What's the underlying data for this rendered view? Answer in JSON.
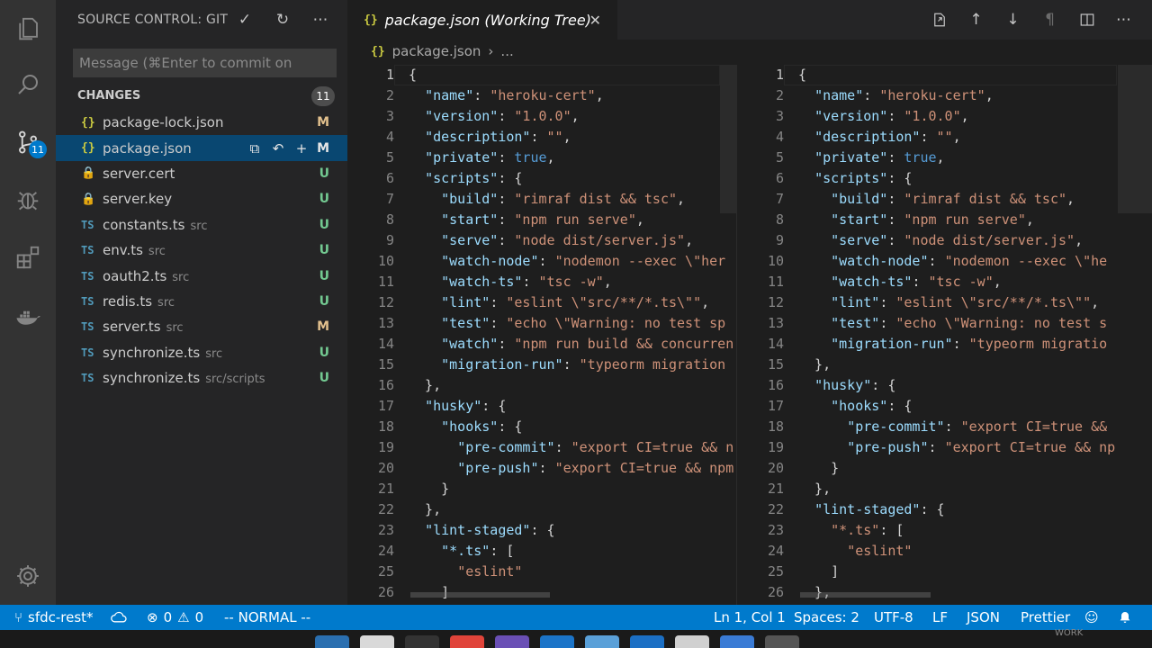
{
  "activity_bar": {
    "items": [
      {
        "name": "explorer-icon"
      },
      {
        "name": "search-icon"
      },
      {
        "name": "source-control-icon",
        "badge": "11"
      },
      {
        "name": "debug-icon"
      },
      {
        "name": "extensions-icon"
      },
      {
        "name": "docker-icon"
      },
      {
        "name": "settings-gear-icon"
      }
    ]
  },
  "sidebar": {
    "title": "SOURCE CONTROL: GIT",
    "actions": [
      "commit-check-icon",
      "refresh-icon",
      "more-actions-icon"
    ],
    "commit_placeholder": "Message (⌘Enter to commit on",
    "changes_label": "CHANGES",
    "changes_count": "11",
    "files": [
      {
        "icon": "{}",
        "type": "json",
        "name": "package-lock.json",
        "dir": "",
        "status": "M"
      },
      {
        "icon": "{}",
        "type": "json",
        "name": "package.json",
        "dir": "",
        "status": "M",
        "selected": true
      },
      {
        "icon": "🔒",
        "type": "lock",
        "name": "server.cert",
        "dir": "",
        "status": "U"
      },
      {
        "icon": "🔒",
        "type": "lock",
        "name": "server.key",
        "dir": "",
        "status": "U"
      },
      {
        "icon": "TS",
        "type": "ts",
        "name": "constants.ts",
        "dir": "src",
        "status": "U"
      },
      {
        "icon": "TS",
        "type": "ts",
        "name": "env.ts",
        "dir": "src",
        "status": "U"
      },
      {
        "icon": "TS",
        "type": "ts",
        "name": "oauth2.ts",
        "dir": "src",
        "status": "U"
      },
      {
        "icon": "TS",
        "type": "ts",
        "name": "redis.ts",
        "dir": "src",
        "status": "U"
      },
      {
        "icon": "TS",
        "type": "ts",
        "name": "server.ts",
        "dir": "src",
        "status": "M"
      },
      {
        "icon": "TS",
        "type": "ts",
        "name": "synchronize.ts",
        "dir": "src",
        "status": "U"
      },
      {
        "icon": "TS",
        "type": "ts",
        "name": "synchronize.ts",
        "dir": "src/scripts",
        "status": "U"
      }
    ]
  },
  "editor": {
    "tab_icon": "{}",
    "tab_title": "package.json (Working Tree)",
    "tab_close": "✕",
    "actions": [
      "open-file-icon",
      "arrow-up-icon",
      "arrow-down-icon",
      "pilcrow-icon",
      "split-editor-icon",
      "more-icon"
    ],
    "breadcrumb_icon": "{}",
    "breadcrumb_file": "package.json",
    "breadcrumb_sep": "›",
    "breadcrumb_more": "...",
    "left_lines": [
      [
        [
          "p",
          "{"
        ]
      ],
      [
        [
          "p",
          "  "
        ],
        [
          "k",
          "\"name\""
        ],
        [
          "p",
          ": "
        ],
        [
          "s",
          "\"heroku-cert\""
        ],
        [
          "p",
          ","
        ]
      ],
      [
        [
          "p",
          "  "
        ],
        [
          "k",
          "\"version\""
        ],
        [
          "p",
          ": "
        ],
        [
          "s",
          "\"1.0.0\""
        ],
        [
          "p",
          ","
        ]
      ],
      [
        [
          "p",
          "  "
        ],
        [
          "k",
          "\"description\""
        ],
        [
          "p",
          ": "
        ],
        [
          "s",
          "\"\""
        ],
        [
          "p",
          ","
        ]
      ],
      [
        [
          "p",
          "  "
        ],
        [
          "k",
          "\"private\""
        ],
        [
          "p",
          ": "
        ],
        [
          "b",
          "true"
        ],
        [
          "p",
          ","
        ]
      ],
      [
        [
          "p",
          "  "
        ],
        [
          "k",
          "\"scripts\""
        ],
        [
          "p",
          ": {"
        ]
      ],
      [
        [
          "p",
          "    "
        ],
        [
          "k",
          "\"build\""
        ],
        [
          "p",
          ": "
        ],
        [
          "s",
          "\"rimraf dist && tsc\""
        ],
        [
          "p",
          ","
        ]
      ],
      [
        [
          "p",
          "    "
        ],
        [
          "k",
          "\"start\""
        ],
        [
          "p",
          ": "
        ],
        [
          "s",
          "\"npm run serve\""
        ],
        [
          "p",
          ","
        ]
      ],
      [
        [
          "p",
          "    "
        ],
        [
          "k",
          "\"serve\""
        ],
        [
          "p",
          ": "
        ],
        [
          "s",
          "\"node dist/server.js\""
        ],
        [
          "p",
          ","
        ]
      ],
      [
        [
          "p",
          "    "
        ],
        [
          "k",
          "\"watch-node\""
        ],
        [
          "p",
          ": "
        ],
        [
          "s",
          "\"nodemon --exec \\\"her"
        ]
      ],
      [
        [
          "p",
          "    "
        ],
        [
          "k",
          "\"watch-ts\""
        ],
        [
          "p",
          ": "
        ],
        [
          "s",
          "\"tsc -w\""
        ],
        [
          "p",
          ","
        ]
      ],
      [
        [
          "p",
          "    "
        ],
        [
          "k",
          "\"lint\""
        ],
        [
          "p",
          ": "
        ],
        [
          "s",
          "\"eslint \\\"src/**/*.ts\\\"\""
        ],
        [
          "p",
          ","
        ]
      ],
      [
        [
          "p",
          "    "
        ],
        [
          "k",
          "\"test\""
        ],
        [
          "p",
          ": "
        ],
        [
          "s",
          "\"echo \\\"Warning: no test sp"
        ]
      ],
      [
        [
          "p",
          "    "
        ],
        [
          "k",
          "\"watch\""
        ],
        [
          "p",
          ": "
        ],
        [
          "s",
          "\"npm run build && concurren"
        ]
      ],
      [
        [
          "p",
          "    "
        ],
        [
          "k",
          "\"migration-run\""
        ],
        [
          "p",
          ": "
        ],
        [
          "s",
          "\"typeorm migration "
        ]
      ],
      [
        [
          "p",
          "  },"
        ]
      ],
      [
        [
          "p",
          "  "
        ],
        [
          "k",
          "\"husky\""
        ],
        [
          "p",
          ": {"
        ]
      ],
      [
        [
          "p",
          "    "
        ],
        [
          "k",
          "\"hooks\""
        ],
        [
          "p",
          ": {"
        ]
      ],
      [
        [
          "p",
          "      "
        ],
        [
          "k",
          "\"pre-commit\""
        ],
        [
          "p",
          ": "
        ],
        [
          "s",
          "\"export CI=true && n"
        ]
      ],
      [
        [
          "p",
          "      "
        ],
        [
          "k",
          "\"pre-push\""
        ],
        [
          "p",
          ": "
        ],
        [
          "s",
          "\"export CI=true && npm"
        ]
      ],
      [
        [
          "p",
          "    }"
        ]
      ],
      [
        [
          "p",
          "  },"
        ]
      ],
      [
        [
          "p",
          "  "
        ],
        [
          "k",
          "\"lint-staged\""
        ],
        [
          "p",
          ": {"
        ]
      ],
      [
        [
          "p",
          "    "
        ],
        [
          "k",
          "\"*.ts\""
        ],
        [
          "p",
          ": ["
        ]
      ],
      [
        [
          "p",
          "      "
        ],
        [
          "s",
          "\"eslint\""
        ]
      ],
      [
        [
          "p",
          "    ]"
        ]
      ]
    ],
    "right_lines": [
      [
        [
          "p",
          "{"
        ]
      ],
      [
        [
          "p",
          "  "
        ],
        [
          "k",
          "\"name\""
        ],
        [
          "p",
          ": "
        ],
        [
          "s",
          "\"heroku-cert\""
        ],
        [
          "p",
          ","
        ]
      ],
      [
        [
          "p",
          "  "
        ],
        [
          "k",
          "\"version\""
        ],
        [
          "p",
          ": "
        ],
        [
          "s",
          "\"1.0.0\""
        ],
        [
          "p",
          ","
        ]
      ],
      [
        [
          "p",
          "  "
        ],
        [
          "k",
          "\"description\""
        ],
        [
          "p",
          ": "
        ],
        [
          "s",
          "\"\""
        ],
        [
          "p",
          ","
        ]
      ],
      [
        [
          "p",
          "  "
        ],
        [
          "k",
          "\"private\""
        ],
        [
          "p",
          ": "
        ],
        [
          "b",
          "true"
        ],
        [
          "p",
          ","
        ]
      ],
      [
        [
          "p",
          "  "
        ],
        [
          "k",
          "\"scripts\""
        ],
        [
          "p",
          ": {"
        ]
      ],
      [
        [
          "p",
          "    "
        ],
        [
          "k",
          "\"build\""
        ],
        [
          "p",
          ": "
        ],
        [
          "s",
          "\"rimraf dist && tsc\""
        ],
        [
          "p",
          ","
        ]
      ],
      [
        [
          "p",
          "    "
        ],
        [
          "k",
          "\"start\""
        ],
        [
          "p",
          ": "
        ],
        [
          "s",
          "\"npm run serve\""
        ],
        [
          "p",
          ","
        ]
      ],
      [
        [
          "p",
          "    "
        ],
        [
          "k",
          "\"serve\""
        ],
        [
          "p",
          ": "
        ],
        [
          "s",
          "\"node dist/server.js\""
        ],
        [
          "p",
          ","
        ]
      ],
      [
        [
          "p",
          "    "
        ],
        [
          "k",
          "\"watch-node\""
        ],
        [
          "p",
          ": "
        ],
        [
          "s",
          "\"nodemon --exec \\\"he"
        ]
      ],
      [
        [
          "p",
          "    "
        ],
        [
          "k",
          "\"watch-ts\""
        ],
        [
          "p",
          ": "
        ],
        [
          "s",
          "\"tsc -w\""
        ],
        [
          "p",
          ","
        ]
      ],
      [
        [
          "p",
          "    "
        ],
        [
          "k",
          "\"lint\""
        ],
        [
          "p",
          ": "
        ],
        [
          "s",
          "\"eslint \\\"src/**/*.ts\\\"\""
        ],
        [
          "p",
          ","
        ]
      ],
      [
        [
          "p",
          "    "
        ],
        [
          "k",
          "\"test\""
        ],
        [
          "p",
          ": "
        ],
        [
          "s",
          "\"echo \\\"Warning: no test s"
        ]
      ],
      [
        [
          "p",
          "    "
        ],
        [
          "k",
          "\"migration-run\""
        ],
        [
          "p",
          ": "
        ],
        [
          "s",
          "\"typeorm migratio"
        ]
      ],
      [
        [
          "p",
          "  },"
        ]
      ],
      [
        [
          "p",
          "  "
        ],
        [
          "k",
          "\"husky\""
        ],
        [
          "p",
          ": {"
        ]
      ],
      [
        [
          "p",
          "    "
        ],
        [
          "k",
          "\"hooks\""
        ],
        [
          "p",
          ": {"
        ]
      ],
      [
        [
          "p",
          "      "
        ],
        [
          "k",
          "\"pre-commit\""
        ],
        [
          "p",
          ": "
        ],
        [
          "s",
          "\"export CI=true &&"
        ]
      ],
      [
        [
          "p",
          "      "
        ],
        [
          "k",
          "\"pre-push\""
        ],
        [
          "p",
          ": "
        ],
        [
          "s",
          "\"export CI=true && np"
        ]
      ],
      [
        [
          "p",
          "    }"
        ]
      ],
      [
        [
          "p",
          "  },"
        ]
      ],
      [
        [
          "p",
          "  "
        ],
        [
          "k",
          "\"lint-staged\""
        ],
        [
          "p",
          ": {"
        ]
      ],
      [
        [
          "p",
          "    "
        ],
        [
          "s",
          "\"*.ts\""
        ],
        [
          "p",
          ": ["
        ]
      ],
      [
        [
          "p",
          "      "
        ],
        [
          "s",
          "\"eslint\""
        ]
      ],
      [
        [
          "p",
          "    ]"
        ]
      ],
      [
        [
          "p",
          "  },"
        ]
      ]
    ]
  },
  "statusbar": {
    "branch": "sfdc-rest*",
    "errors": "0",
    "warnings": "0",
    "mode": "-- NORMAL --",
    "position": "Ln 1, Col 1",
    "spaces": "Spaces: 2",
    "encoding": "UTF-8",
    "eol": "LF",
    "language": "JSON",
    "formatter": "Prettier"
  },
  "dock": {
    "label": "WORK",
    "icons": [
      "#2a6fb0",
      "#d9d9d9",
      "#333333",
      "#e0443a",
      "#6a4fb5",
      "#1b74c8",
      "#5aa0d8",
      "#1b6fc4",
      "#d0d0d0",
      "#3a7bd5",
      "#555555"
    ]
  },
  "colors": {
    "accent": "#007acc",
    "modified": "#e2c08d",
    "untracked": "#73c991",
    "selection": "#094771"
  }
}
